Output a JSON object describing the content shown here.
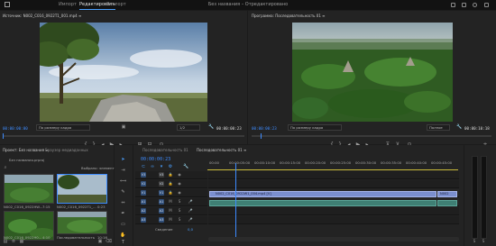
{
  "topbar": {
    "tabs": [
      "Импорт",
      "Редактировать",
      "Экспорт"
    ],
    "active_tab": "Редактировать",
    "title": "Без названия – Отредактировано"
  },
  "source_monitor": {
    "title": "Источник: N002_C016_0922T1_001.mp4 ≡",
    "timecode_left": "00:00:00:00",
    "fit": "По размеру кадра",
    "quality": "1/2",
    "timecode_right": "00:00:00:23"
  },
  "program_monitor": {
    "title": "Программа: Последовательность 01 ≡",
    "timecode_left": "00:00:00:23",
    "fit": "По размеру кадра",
    "quality": "Полное",
    "timecode_right": "00:00:10:18"
  },
  "project_panel": {
    "tabs": [
      "Проект: Без названия ≡",
      "Браузер медиаданных"
    ],
    "project_file": "Без названия.prproj",
    "selected_count": "Выбрано: элемент",
    "items": [
      {
        "name": "N002_C016_0922HW...",
        "duration": "7:15"
      },
      {
        "name": "N002_C016_0922T1_...",
        "duration": "0:23"
      },
      {
        "name": "N002_C016_0922H0...",
        "duration": "4:10"
      },
      {
        "name": "Последовательность",
        "duration": "10:16"
      }
    ]
  },
  "timeline": {
    "tabs": [
      "Последовательность 01",
      "Последовательность 01 ≡"
    ],
    "timecode": "00:00:00:23",
    "ruler": [
      "00:00",
      "00:00:05:00",
      "00:00:10:00",
      "00:00:15:00",
      "00:00:20:00",
      "00:00:25:00",
      "00:00:30:00",
      "00:00:35:00",
      "00:00:40:00",
      "00:00:45:00"
    ],
    "video_tracks": [
      "V3",
      "V2",
      "V1"
    ],
    "audio_tracks": [
      "A1",
      "A2",
      "A3"
    ],
    "clip_name": "N002_C016_0922W1_004.mp4 [V]",
    "clip_name_right": "N002",
    "mix_label": "Сведение",
    "mix_value": "0,0"
  },
  "colors": {
    "accent": "#3d8bff",
    "clip": "#7b8fcf",
    "audio": "#3f7f74"
  }
}
